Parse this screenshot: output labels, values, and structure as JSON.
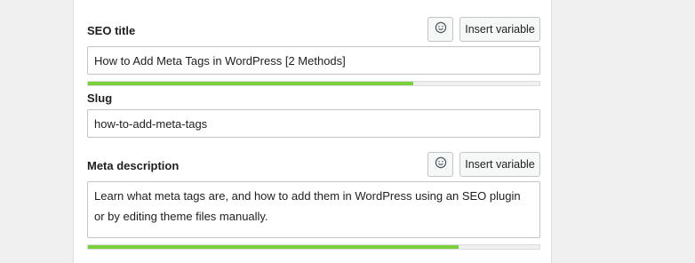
{
  "seo_title": {
    "label": "SEO title",
    "insert_variable_label": "Insert variable",
    "value": "How to Add Meta Tags in WordPress [2 Methods]",
    "progress_fraction": 0.72
  },
  "slug": {
    "label": "Slug",
    "value": "how-to-add-meta-tags"
  },
  "meta_description": {
    "label": "Meta description",
    "insert_variable_label": "Insert variable",
    "value": "Learn what meta tags are, and how to add them in WordPress using an SEO plugin or by editing theme files manually.",
    "progress_fraction": 0.82
  },
  "colors": {
    "progress_good": "#7ad03a",
    "progress_track": "#f0f0f1",
    "panel_background": "#ffffff",
    "page_background": "#f0f0f1"
  },
  "icons": {
    "emoji_button": "smiley-face-icon"
  }
}
